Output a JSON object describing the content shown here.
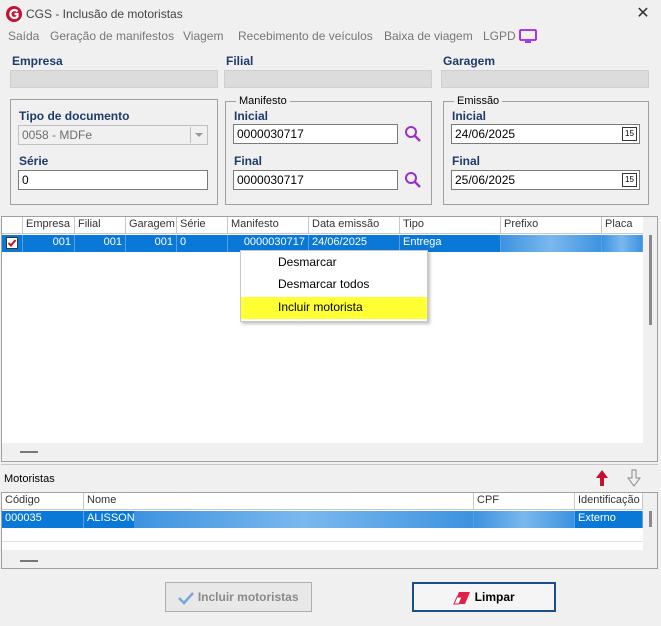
{
  "window": {
    "title": "CGS - Inclusão de motoristas",
    "close_glyph": "✕"
  },
  "menu": [
    "Saída",
    "Geração de manifestos",
    "Viagem",
    "Recebimento de veículos",
    "Baixa de viagem",
    "LGPD"
  ],
  "header": {
    "empresa_label": "Empresa",
    "filial_label": "Filial",
    "garagem_label": "Garagem"
  },
  "filters": {
    "tipo_documento_label": "Tipo de documento",
    "tipo_documento_value": "0058 - MDFe",
    "serie_label": "Série",
    "serie_value": "0",
    "manifesto_group": "Manifesto",
    "manifesto_inicial_label": "Inicial",
    "manifesto_inicial_value": "0000030717",
    "manifesto_final_label": "Final",
    "manifesto_final_value": "0000030717",
    "emissao_group": "Emissão",
    "emissao_inicial_label": "Inicial",
    "emissao_inicial_value": "24/06/2025",
    "emissao_final_label": "Final",
    "emissao_final_value": "25/06/2025",
    "calendar_glyph": "15"
  },
  "manifest_grid": {
    "columns": [
      "Empresa",
      "Filial",
      "Garagem",
      "Série",
      "Manifesto",
      "Data emissão",
      "Tipo",
      "Prefixo",
      "Placa"
    ],
    "rows": [
      {
        "checked": true,
        "empresa": "001",
        "filial": "001",
        "garagem": "001",
        "serie": "0",
        "manifesto": "0000030717",
        "data_emissao": "24/06/2025",
        "tipo": "Entrega"
      }
    ]
  },
  "context_menu": {
    "items": [
      "Desmarcar",
      "Desmarcar todos",
      "Incluir motorista"
    ],
    "highlighted_index": 2
  },
  "drivers": {
    "section_label": "Motoristas",
    "columns": [
      "Código",
      "Nome",
      "CPF",
      "Identificação"
    ],
    "rows": [
      {
        "codigo": "000035",
        "nome": "ALISSON",
        "identificacao": "Externo"
      }
    ]
  },
  "buttons": {
    "incluir_label": "Incluir motoristas",
    "limpar_label": "Limpar"
  },
  "colors": {
    "selection": "#0a78d7",
    "highlight": "#ffff33",
    "accent_red": "#c8102e",
    "label_blue": "#1f3b6b"
  }
}
